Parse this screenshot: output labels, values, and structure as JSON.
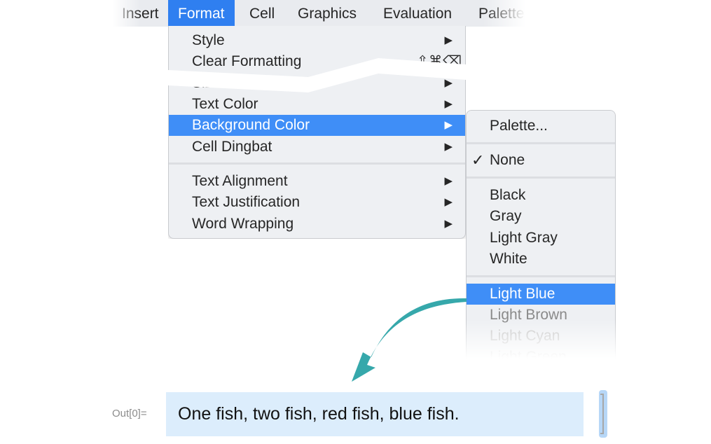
{
  "menubar": {
    "items": [
      {
        "label": "Insert"
      },
      {
        "label": "Format",
        "active": true
      },
      {
        "label": "Cell"
      },
      {
        "label": "Graphics"
      },
      {
        "label": "Evaluation"
      },
      {
        "label": "Palettes"
      }
    ]
  },
  "format_menu": {
    "items": [
      {
        "label": "Style",
        "submenu_arrow": "▶"
      },
      {
        "label": "Clear Formatting",
        "shortcut": "⇧⌘⌫"
      },
      {
        "label": "Size",
        "submenu_arrow": "▶"
      },
      {
        "label": "Text Color",
        "submenu_arrow": "▶"
      },
      {
        "label": "Background Color",
        "submenu_arrow": "▶",
        "highlighted": true
      },
      {
        "label": "Cell Dingbat",
        "submenu_arrow": "▶"
      },
      {
        "label": "Text Alignment",
        "submenu_arrow": "▶"
      },
      {
        "label": "Text Justification",
        "submenu_arrow": "▶"
      },
      {
        "label": "Word Wrapping",
        "submenu_arrow": "▶"
      }
    ]
  },
  "background_color_submenu": {
    "checkmark": "✓",
    "items": [
      {
        "label": "Palette..."
      },
      {
        "label": "None",
        "checked": true
      },
      {
        "label": "Black"
      },
      {
        "label": "Gray"
      },
      {
        "label": "Light Gray"
      },
      {
        "label": "White"
      },
      {
        "label": "Light Blue",
        "highlighted": true
      },
      {
        "label": "Light Brown"
      },
      {
        "label": "Light Cyan"
      },
      {
        "label": "Light Green"
      }
    ]
  },
  "output_cell": {
    "label": "Out[0]=",
    "text": "One fish, two fish, red fish, blue fish.",
    "background_color": "#dcedfc"
  },
  "colors": {
    "menu_highlight": "#3f8ef7",
    "menubar_active": "#2f7ff0",
    "arrow_teal": "#36a8ab"
  }
}
